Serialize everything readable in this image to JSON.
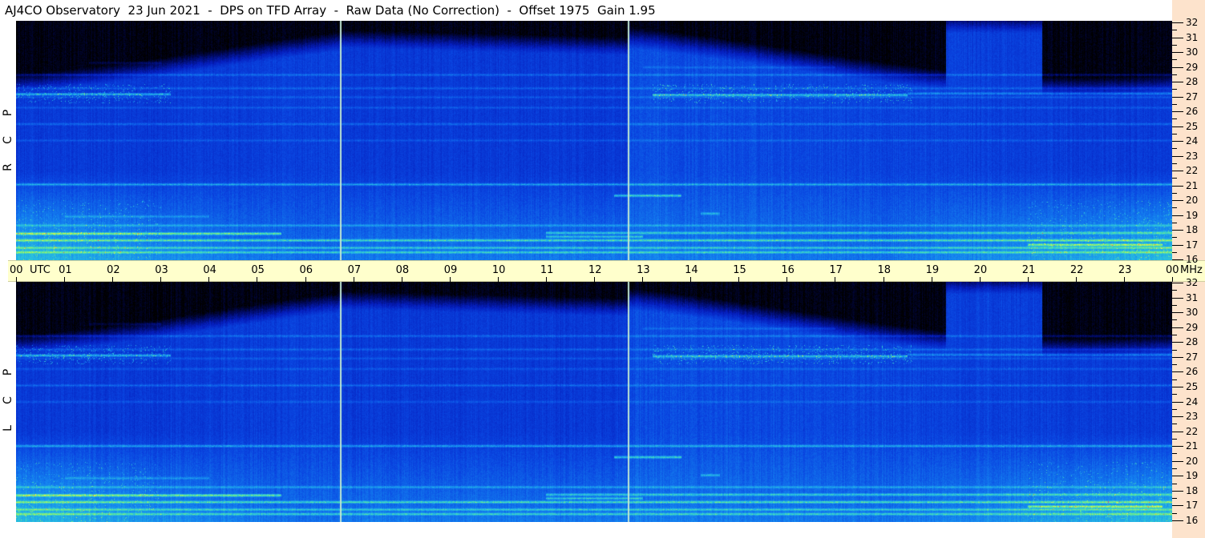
{
  "title": "AJ4CO Observatory  23 Jun 2021  -  DPS on TFD Array  -  Raw Data (No Correction)  -  Offset 1975  Gain 1.95",
  "colors": {
    "background": "#ffffff",
    "time_axis_bg": "#ffffcc",
    "freq_axis_bg": "#fde3cc",
    "sky_floor": "#0a3bd6",
    "night_sky": "#000010",
    "marker_line": "#bfe6d2"
  },
  "panels": [
    {
      "id": "rcp",
      "letters": [
        "R",
        "C",
        "P"
      ]
    },
    {
      "id": "lcp",
      "letters": [
        "L",
        "C",
        "P"
      ]
    }
  ],
  "chart_data": {
    "type": "heatmap",
    "title": "AJ4CO Observatory  23 Jun 2021  -  DPS on TFD Array  -  Raw Data (No Correction)  -  Offset 1975  Gain 1.95",
    "x_axis": {
      "unit": "UTC",
      "range_hours": [
        0,
        24
      ],
      "tick_labels": [
        "00",
        "01",
        "02",
        "03",
        "04",
        "05",
        "06",
        "07",
        "08",
        "09",
        "10",
        "11",
        "12",
        "13",
        "14",
        "15",
        "16",
        "17",
        "18",
        "19",
        "20",
        "21",
        "22",
        "23",
        "00"
      ],
      "unit_label": "UTC"
    },
    "y_axis": {
      "unit": "MHz",
      "range": [
        16,
        32
      ],
      "tick_labels": [
        "32",
        "31",
        "30",
        "29",
        "28",
        "27",
        "26",
        "25",
        "24",
        "23",
        "22",
        "21",
        "20",
        "19",
        "18",
        "17",
        "16"
      ],
      "unit_label": "MHz"
    },
    "series": [
      {
        "name": "R C P",
        "polarization": "RCP"
      },
      {
        "name": "L C P",
        "polarization": "LCP"
      }
    ],
    "marker_lines_hours": [
      6.73,
      12.7
    ],
    "colormap": [
      "#000000",
      "#0010a0",
      "#0a3bd6",
      "#1e90ff",
      "#40d0e0",
      "#80ff80",
      "#ffff40",
      "#ff8020",
      "#ff2040",
      "#c040c0"
    ]
  }
}
